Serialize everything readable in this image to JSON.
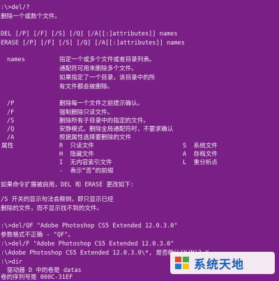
{
  "console": {
    "lines": [
      ":\\>del/?",
      "删除一个或数个文件。",
      "DEL [/P] [/F] [/S] [/Q] [/A[[:]attributes]] names",
      "ERASE [/P] [/F] [/S] [/Q] [/A[[:]attributes]] names",
      "names",
      "指定一个或多个文件或者目录列表。",
      "通配符可用来删除多个文件。",
      "如果指定了一个目录，该目录中的所",
      "有文件都会被删除。",
      "/P",
      "删除每一个文件之前提示确认。",
      "/F",
      "强制删除只读文件。",
      "/S",
      "删除所有子目录中的指定的文件。",
      "/Q",
      "安静模式。删除全局通配符时，不要求确认",
      "/A",
      "根据属性选择要删除的文件",
      "属性",
      "R  只读文件",
      "S  系统文件",
      "H  隐藏文件",
      "A  存档文件",
      "I  无内容索引文件",
      "L  重分析点",
      "-  表示“否”的前缀",
      "如果命令扩展被启用，DEL 和 ERASE 更改如下:",
      "/S 开关的显示句法会颠倒，即只显示已经",
      "删除的文件，而不显示找不到的文件。",
      ":\\>del/QF \"Adobe Photoshop CS5 Extended 12.0.3.0\"",
      "参数格式不正确 - \"QF\"。",
      ":\\>del/F \"Adobe Photoshop CS5 Extended 12.0.3.0\"",
      ":\\Adobe Photoshop CS5 Extended 12.0.3.0\\*, 是否确认(Y/N)? Y",
      ":\\>dir",
      "驱动器 D 中的卷是 datas",
      "卷的序列号是 000C-31EF"
    ]
  },
  "watermark": {
    "text": "系统天地",
    "logo_icon": "windows-flag-icon",
    "color": "#1b5fb5"
  },
  "colors": {
    "background": "#7a1f85",
    "text": "#f2eef2"
  }
}
